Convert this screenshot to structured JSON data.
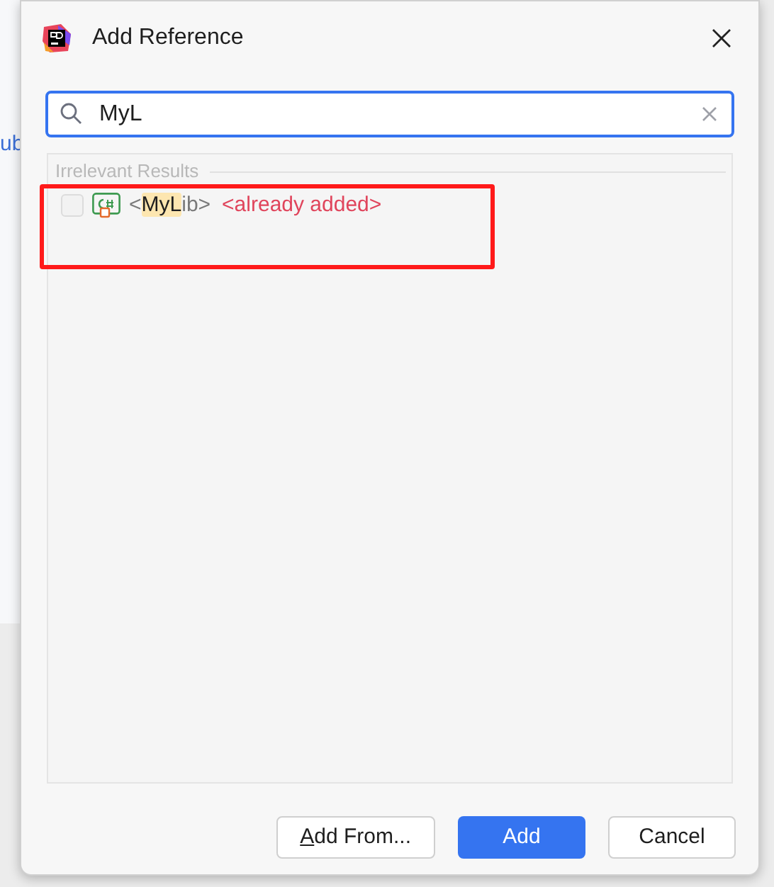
{
  "background": {
    "text": "ub"
  },
  "window": {
    "title": "Add Reference"
  },
  "search": {
    "value": "MyL"
  },
  "results": {
    "group_title": "Irrelevant Results",
    "items": [
      {
        "checked": false,
        "prefix": "<",
        "highlight": "MyL",
        "suffix": "ib>",
        "note": "<already added>"
      }
    ]
  },
  "buttons": [
    {
      "label": "Add From...",
      "mnemonic_underlined": true,
      "primary": false
    },
    {
      "label": "Add",
      "primary": true
    },
    {
      "label": "Cancel",
      "primary": false
    }
  ]
}
